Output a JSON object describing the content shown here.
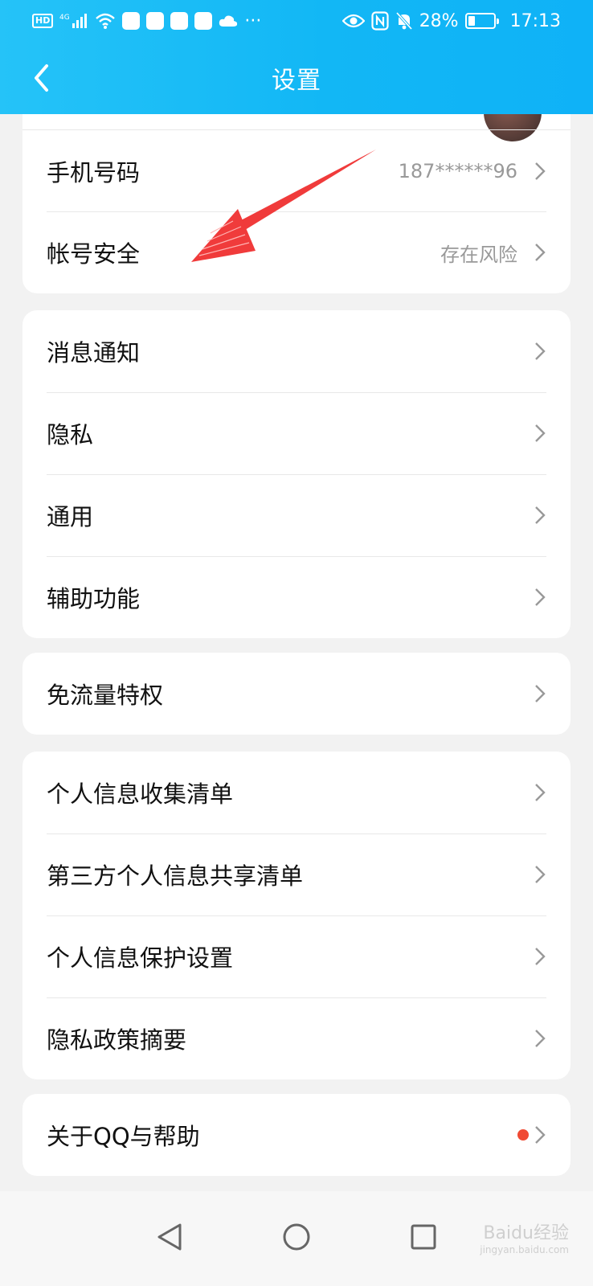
{
  "status_bar": {
    "hd": "HD",
    "network": "4G",
    "more": "···",
    "battery": "28%",
    "time": "17:13"
  },
  "header": {
    "title": "设置",
    "back_icon": "chevron-left-icon"
  },
  "account_section": {
    "items": [
      {
        "label": "手机号码",
        "value": "187******96"
      },
      {
        "label": "帐号安全",
        "value": "存在风险"
      }
    ]
  },
  "general_section": {
    "items": [
      {
        "label": "消息通知"
      },
      {
        "label": "隐私"
      },
      {
        "label": "通用"
      },
      {
        "label": "辅助功能"
      }
    ]
  },
  "data_section": {
    "items": [
      {
        "label": "免流量特权"
      }
    ]
  },
  "privacy_section": {
    "items": [
      {
        "label": "个人信息收集清单"
      },
      {
        "label": "第三方个人信息共享清单"
      },
      {
        "label": "个人信息保护设置"
      },
      {
        "label": "隐私政策摘要"
      }
    ]
  },
  "about_section": {
    "items": [
      {
        "label": "关于QQ与帮助",
        "has_badge": true
      }
    ]
  },
  "colors": {
    "header": "#12b7f5",
    "badge": "#f04a33",
    "annotation": "#f03b3b"
  },
  "watermark": {
    "text": "Baidu经验",
    "sub": "jingyan.baidu.com"
  }
}
